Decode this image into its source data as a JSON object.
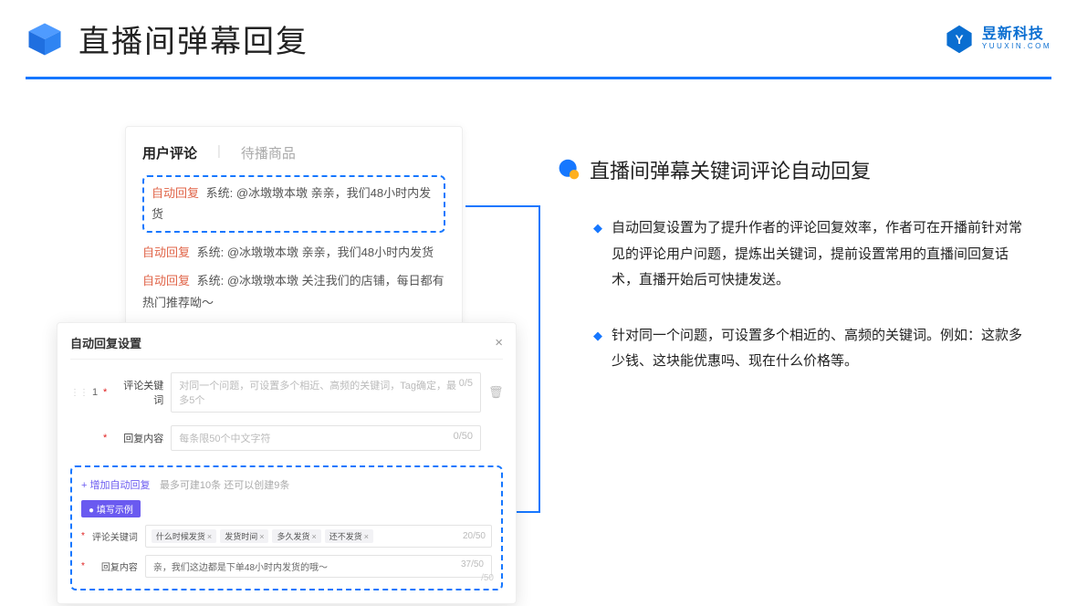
{
  "header": {
    "title": "直播间弹幕回复",
    "brand_name": "昱新科技",
    "brand_sub": "YUUXIN.COM"
  },
  "comments": {
    "tab_active": "用户评论",
    "tab_inactive": "待播商品",
    "items": [
      {
        "badge": "自动回复",
        "text": "系统: @冰墩墩本墩 亲亲，我们48小时内发货"
      },
      {
        "badge": "自动回复",
        "text": "系统: @冰墩墩本墩 亲亲，我们48小时内发货"
      },
      {
        "badge": "自动回复",
        "text": "系统: @冰墩墩本墩 关注我们的店铺，每日都有热门推荐呦～"
      }
    ]
  },
  "settings": {
    "title": "自动回复设置",
    "index": "1",
    "kw_label": "评论关键词",
    "kw_placeholder": "对同一个问题，可设置多个相近、高频的关键词，Tag确定，最多5个",
    "kw_count": "0/5",
    "reply_label": "回复内容",
    "reply_placeholder": "每条限50个中文字符",
    "reply_count": "0/50",
    "add_link": "+ 增加自动回复",
    "add_note": "最多可建10条 还可以创建9条",
    "example_badge": "● 填写示例",
    "ex_kw_label": "评论关键词",
    "ex_tags": [
      "什么时候发货",
      "发货时间",
      "多久发货",
      "还不发货"
    ],
    "ex_kw_count": "20/50",
    "ex_reply_label": "回复内容",
    "ex_reply_text": "亲，我们这边都是下单48小时内发货的哦～",
    "ex_reply_count": "37/50",
    "ghost_count": "/50"
  },
  "right": {
    "section_title": "直播间弹幕关键词评论自动回复",
    "points": [
      "自动回复设置为了提升作者的评论回复效率，作者可在开播前针对常见的评论用户问题，提炼出关键词，提前设置常用的直播间回复话术，直播开始后可快捷发送。",
      "针对同一个问题，可设置多个相近的、高频的关键词。例如：这款多少钱、这块能优惠吗、现在什么价格等。"
    ]
  }
}
